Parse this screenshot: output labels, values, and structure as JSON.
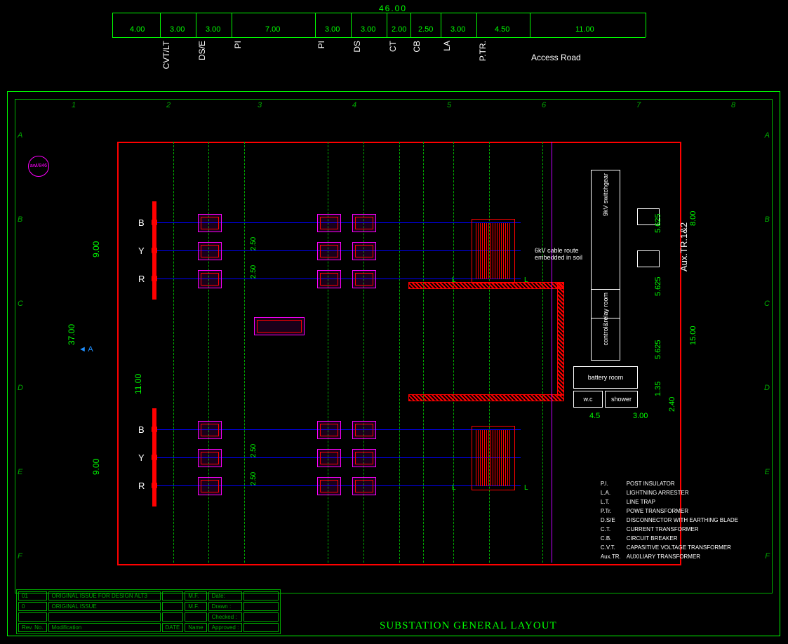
{
  "drawing_title": "SUBSTATION GENERAL LAYOUT",
  "top_dims": {
    "total": "46.00",
    "segments": [
      "4.00",
      "3.00",
      "3.00",
      "7.00",
      "3.00",
      "3.00",
      "2.00",
      "2.50",
      "3.00",
      "4.50",
      "11.00"
    ],
    "labels": [
      "CVT/LT",
      "DS/E",
      "PI",
      "PI",
      "DS",
      "CT",
      "CB",
      "LA",
      "P.TR.",
      "Access Road"
    ]
  },
  "grid": {
    "cols": [
      "1",
      "2",
      "3",
      "4",
      "5",
      "6",
      "7",
      "8"
    ],
    "rows": [
      "A",
      "B",
      "C",
      "D",
      "E",
      "F"
    ]
  },
  "side_dims": {
    "outer": "37.00",
    "inner": "11.00",
    "bay": "9.00",
    "bay2": "9.00"
  },
  "phases": [
    "B",
    "Y",
    "R"
  ],
  "center_spacings": [
    "2.50",
    "2.50",
    "2.50",
    "2.50"
  ],
  "rooms": {
    "sw": "9kV switchgear",
    "cr": "control&relay room",
    "bat": "battery room",
    "wc": "w.c",
    "sh": "shower",
    "aux": "Aux.TR.1&2"
  },
  "room_dims": {
    "r1": "5.625",
    "r2": "5.625",
    "r3": "5.625",
    "r4": "1.35",
    "r5": "2.40",
    "h1": "8.00",
    "h2": "15.00",
    "w1": "4.5",
    "w2": "3.00"
  },
  "cable_note": "6kV cable route embedded in soil",
  "legend": [
    [
      "P.I.",
      "POST INSULATOR"
    ],
    [
      "L.A.",
      "LIGHTNING ARRESTER"
    ],
    [
      "L.T.",
      "LINE TRAP"
    ],
    [
      "P.Tr.",
      "POWE TRANSFORMER"
    ],
    [
      "D.S/E",
      "DISCONNECTOR WITH EARTHING BLADE"
    ],
    [
      "C.T.",
      "CURRENT TRANSFORMER"
    ],
    [
      "C.B.",
      "CIRCUIT BREAKER"
    ],
    [
      "C.V.T.",
      "CAPASITIVE VOLTAGE TRANSFORMER"
    ],
    [
      "Aux.TR.",
      "AUXILIARY TRANSFORMER"
    ]
  ],
  "revisions": [
    {
      "rev": "01",
      "desc": "ORIGINAL ISSUE FOR DESIGN ALT3",
      "by": "M.F."
    },
    {
      "rev": "0",
      "desc": "ORIGINAL ISSUE",
      "by": "M.F."
    }
  ],
  "titleblock": {
    "headers": [
      "Rev. No.",
      "Modification",
      "DATE",
      "Name"
    ],
    "side": [
      "Date:",
      "Drawn :",
      "Checked :",
      "Approved :"
    ]
  },
  "marker": "A",
  "markers_L": "L",
  "circle_text": "awl/846"
}
